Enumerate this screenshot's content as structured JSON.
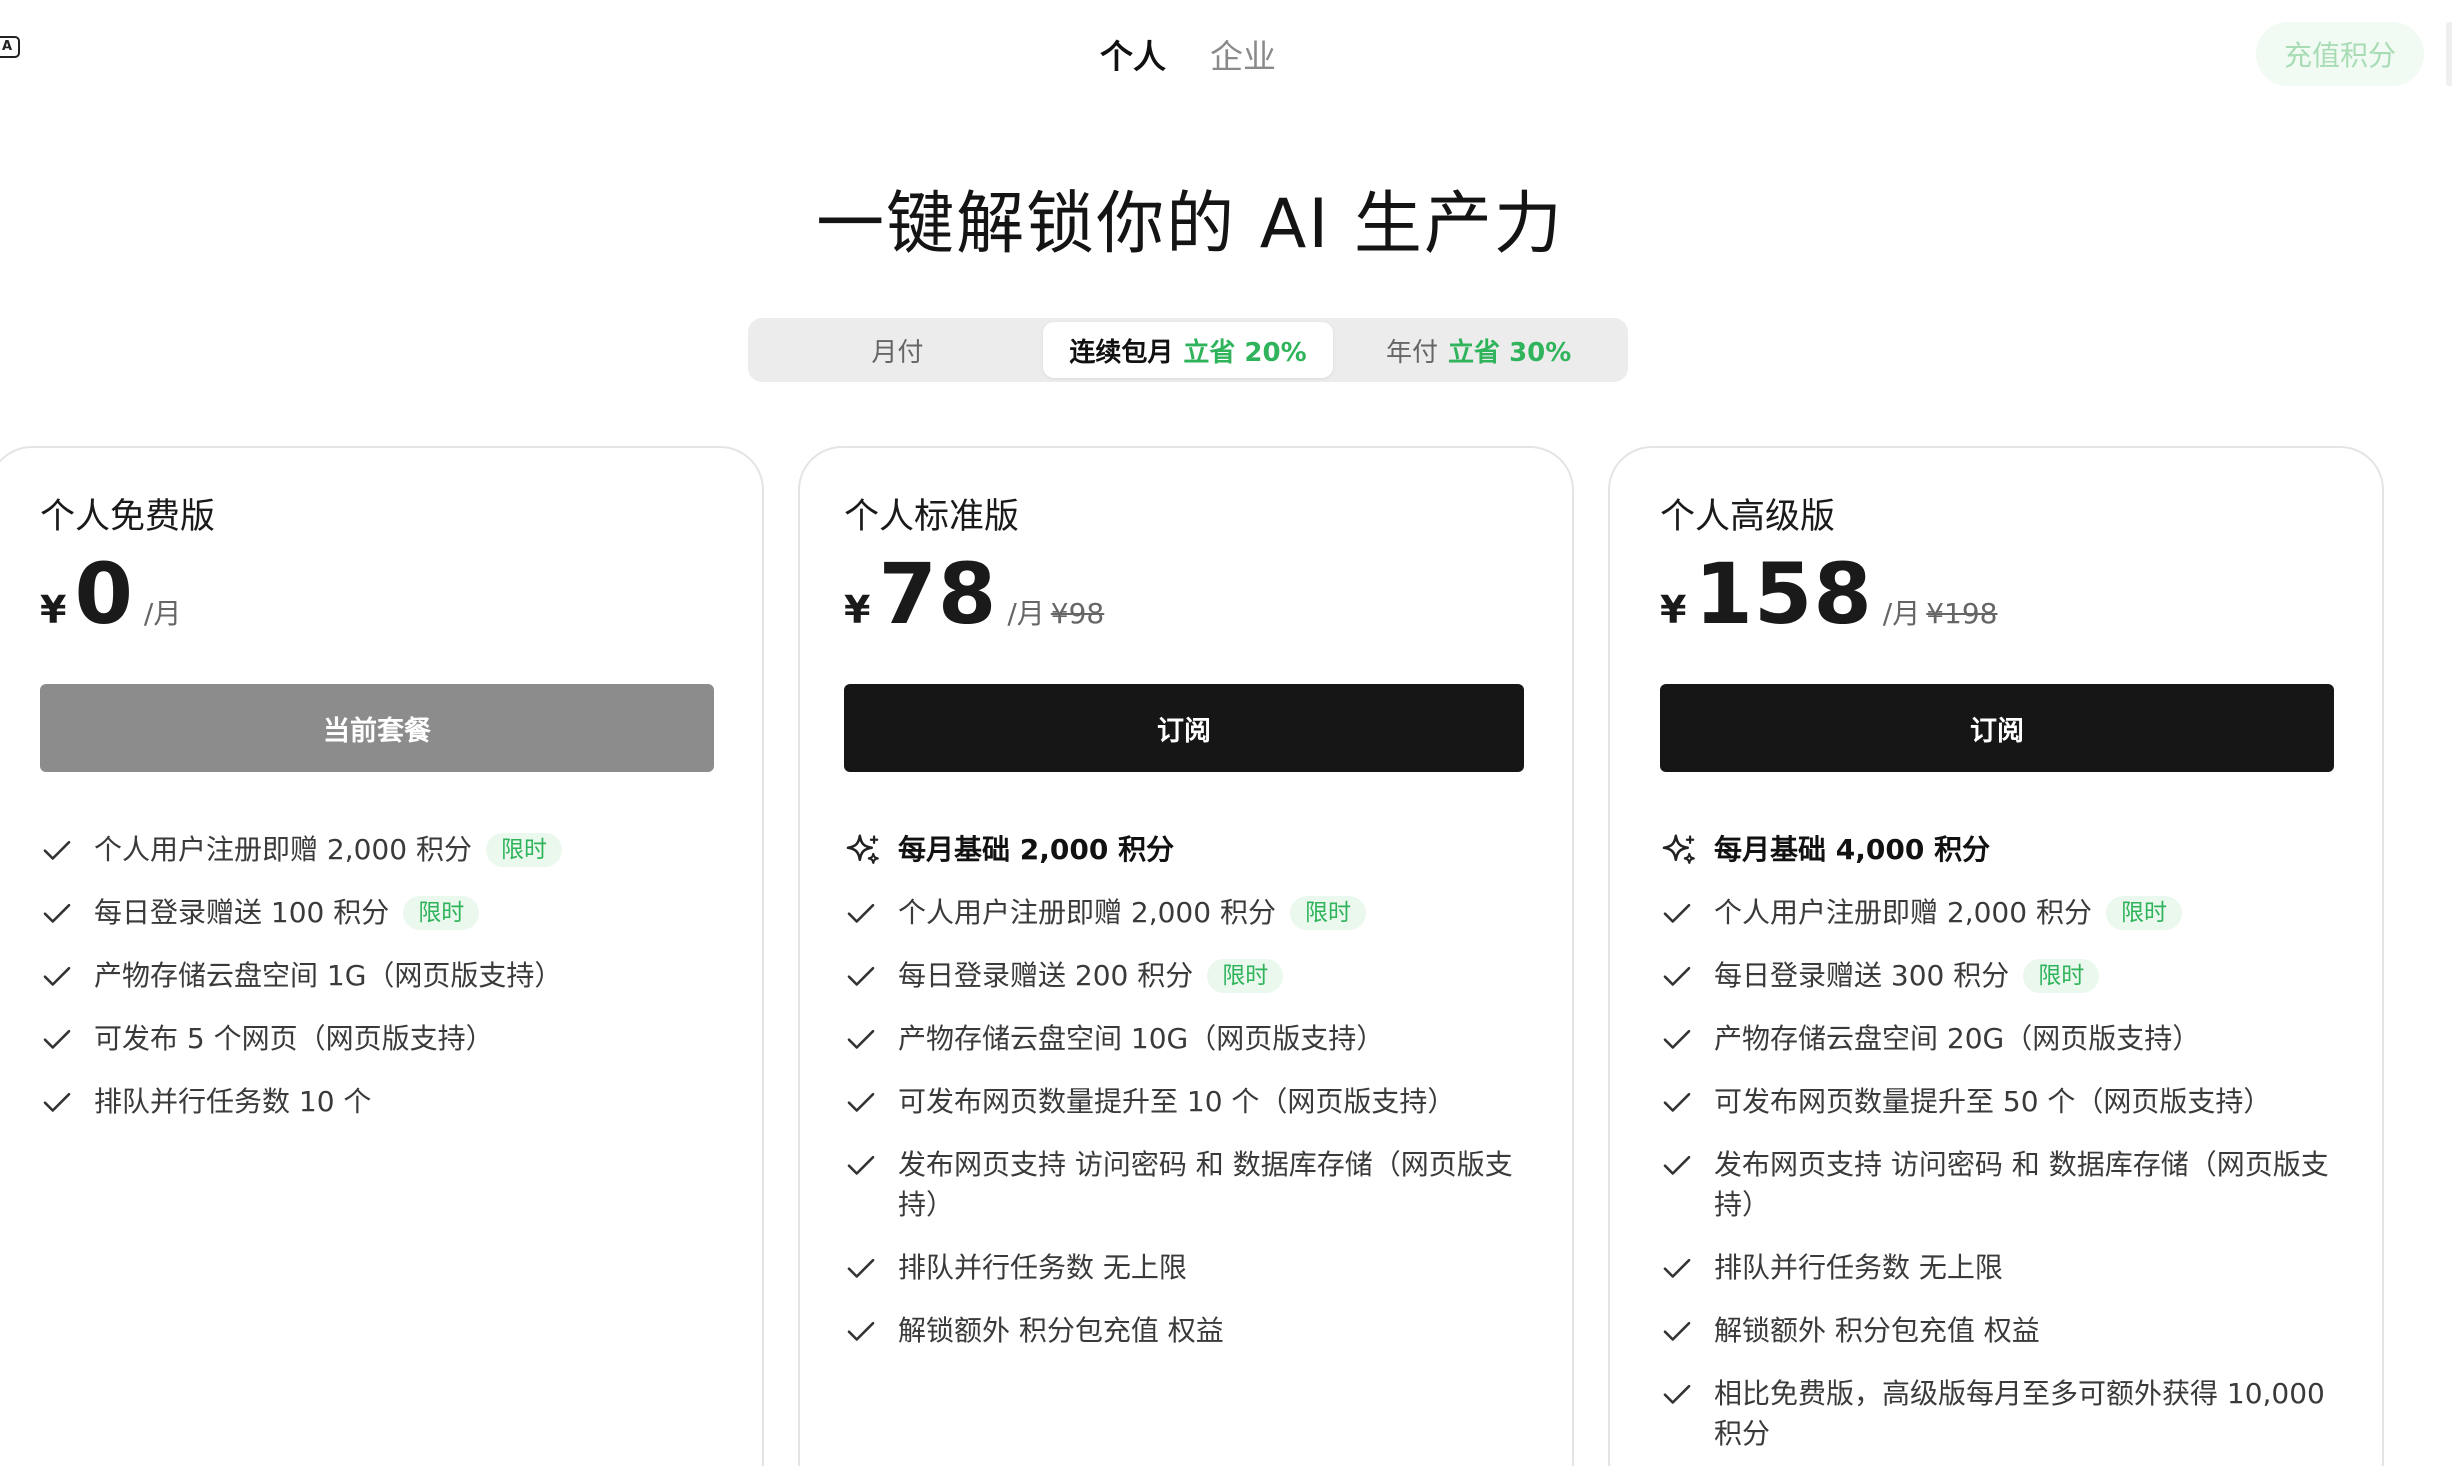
{
  "topbar": {
    "corner_icon_text": "A",
    "mode_tabs": [
      {
        "label": "个人",
        "active": true
      },
      {
        "label": "企业",
        "active": false
      }
    ],
    "recharge_label": "充值积分"
  },
  "headline": "一键解锁你的 AI 生产力",
  "billing": {
    "options": [
      {
        "label": "月付",
        "save": ""
      },
      {
        "label": "连续包月",
        "save": "立省 20%"
      },
      {
        "label": "年付",
        "save": "立省 30%"
      }
    ],
    "selected": "连续包月"
  },
  "plans": [
    {
      "name": "个人免费版",
      "currency": "¥",
      "amount": "0",
      "per": "/月",
      "original": "",
      "cta": "当前套餐",
      "features": [
        {
          "text": "个人用户注册即赠 2,000 积分",
          "badge": "限时"
        },
        {
          "text": "每日登录赠送 100 积分",
          "badge": "限时"
        },
        {
          "text": "产物存储云盘空间 1G（网页版支持）",
          "badge": ""
        },
        {
          "text": "可发布 5 个网页（网页版支持）",
          "badge": ""
        },
        {
          "text": "排队并行任务数 10 个",
          "badge": ""
        }
      ]
    },
    {
      "name": "个人标准版",
      "currency": "¥",
      "amount": "78",
      "per": "/月",
      "original": "¥98",
      "cta": "订阅",
      "highlight": "每月基础 2,000 积分",
      "features": [
        {
          "text": "个人用户注册即赠 2,000 积分",
          "badge": "限时"
        },
        {
          "text": "每日登录赠送 200 积分",
          "badge": "限时"
        },
        {
          "text": "产物存储云盘空间 10G（网页版支持）",
          "badge": ""
        },
        {
          "text": "可发布网页数量提升至 10 个（网页版支持）",
          "badge": ""
        },
        {
          "text": "发布网页支持 访问密码 和 数据库存储（网页版支持）",
          "badge": ""
        },
        {
          "text": "排队并行任务数 无上限",
          "badge": ""
        },
        {
          "text": "解锁额外 积分包充值 权益",
          "badge": ""
        }
      ]
    },
    {
      "name": "个人高级版",
      "currency": "¥",
      "amount": "158",
      "per": "/月",
      "original": "¥198",
      "cta": "订阅",
      "highlight": "每月基础 4,000 积分",
      "features": [
        {
          "text": "个人用户注册即赠 2,000 积分",
          "badge": "限时"
        },
        {
          "text": "每日登录赠送 300 积分",
          "badge": "限时"
        },
        {
          "text": "产物存储云盘空间 20G（网页版支持）",
          "badge": ""
        },
        {
          "text": "可发布网页数量提升至 50 个（网页版支持）",
          "badge": ""
        },
        {
          "text": "发布网页支持 访问密码 和 数据库存储（网页版支持）",
          "badge": ""
        },
        {
          "text": "排队并行任务数 无上限",
          "badge": ""
        },
        {
          "text": "解锁额外 积分包充值 权益",
          "badge": ""
        },
        {
          "text": "相比免费版，高级版每月至多可额外获得 10,000 积分",
          "badge": ""
        }
      ]
    }
  ],
  "colors": {
    "accent_green": "#2fb35b",
    "badge_bg": "#eaf8ee",
    "cta_dark": "#161616",
    "cta_disabled": "#8c8c8c"
  }
}
